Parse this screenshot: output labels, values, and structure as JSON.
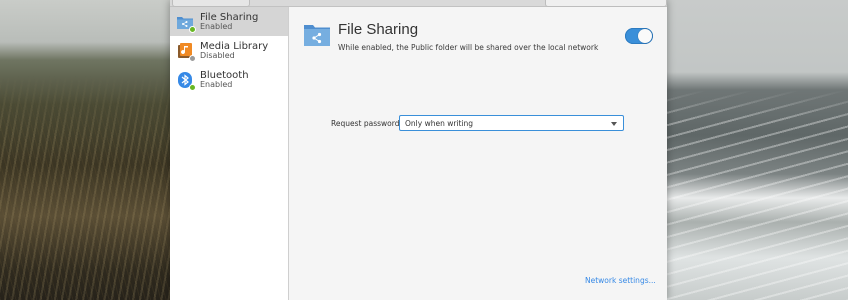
{
  "sidebar": {
    "items": [
      {
        "label": "File Sharing",
        "status": "Enabled",
        "icon": "folder-share-icon",
        "badge": "green"
      },
      {
        "label": "Media Library",
        "status": "Disabled",
        "icon": "media-library-icon",
        "badge": "grey"
      },
      {
        "label": "Bluetooth",
        "status": "Enabled",
        "icon": "bluetooth-icon",
        "badge": "green"
      }
    ]
  },
  "main": {
    "title": "File Sharing",
    "description": "While enabled, the Public folder will be shared over the local network",
    "toggle_on": true,
    "password_label": "Request password:",
    "password_value": "Only when writing",
    "network_link": "Network settings..."
  },
  "colors": {
    "accent": "#3a8fd9",
    "link": "#3689e6",
    "enabled_badge": "#68b723",
    "disabled_badge": "#9a9a9a"
  }
}
